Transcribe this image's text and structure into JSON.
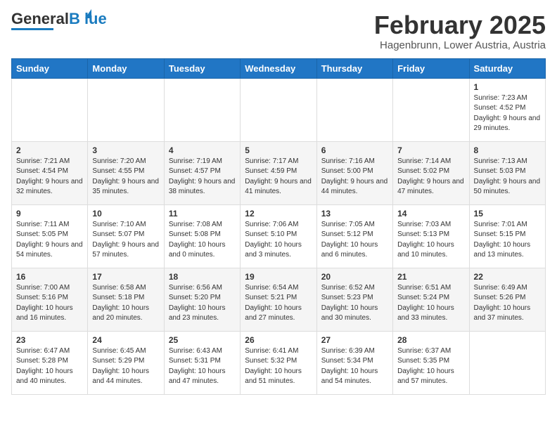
{
  "header": {
    "logo_general": "General",
    "logo_blue": "Blue",
    "month": "February 2025",
    "location": "Hagenbrunn, Lower Austria, Austria"
  },
  "days_of_week": [
    "Sunday",
    "Monday",
    "Tuesday",
    "Wednesday",
    "Thursday",
    "Friday",
    "Saturday"
  ],
  "weeks": [
    [
      {
        "day": "",
        "info": ""
      },
      {
        "day": "",
        "info": ""
      },
      {
        "day": "",
        "info": ""
      },
      {
        "day": "",
        "info": ""
      },
      {
        "day": "",
        "info": ""
      },
      {
        "day": "",
        "info": ""
      },
      {
        "day": "1",
        "info": "Sunrise: 7:23 AM\nSunset: 4:52 PM\nDaylight: 9 hours and 29 minutes."
      }
    ],
    [
      {
        "day": "2",
        "info": "Sunrise: 7:21 AM\nSunset: 4:54 PM\nDaylight: 9 hours and 32 minutes."
      },
      {
        "day": "3",
        "info": "Sunrise: 7:20 AM\nSunset: 4:55 PM\nDaylight: 9 hours and 35 minutes."
      },
      {
        "day": "4",
        "info": "Sunrise: 7:19 AM\nSunset: 4:57 PM\nDaylight: 9 hours and 38 minutes."
      },
      {
        "day": "5",
        "info": "Sunrise: 7:17 AM\nSunset: 4:59 PM\nDaylight: 9 hours and 41 minutes."
      },
      {
        "day": "6",
        "info": "Sunrise: 7:16 AM\nSunset: 5:00 PM\nDaylight: 9 hours and 44 minutes."
      },
      {
        "day": "7",
        "info": "Sunrise: 7:14 AM\nSunset: 5:02 PM\nDaylight: 9 hours and 47 minutes."
      },
      {
        "day": "8",
        "info": "Sunrise: 7:13 AM\nSunset: 5:03 PM\nDaylight: 9 hours and 50 minutes."
      }
    ],
    [
      {
        "day": "9",
        "info": "Sunrise: 7:11 AM\nSunset: 5:05 PM\nDaylight: 9 hours and 54 minutes."
      },
      {
        "day": "10",
        "info": "Sunrise: 7:10 AM\nSunset: 5:07 PM\nDaylight: 9 hours and 57 minutes."
      },
      {
        "day": "11",
        "info": "Sunrise: 7:08 AM\nSunset: 5:08 PM\nDaylight: 10 hours and 0 minutes."
      },
      {
        "day": "12",
        "info": "Sunrise: 7:06 AM\nSunset: 5:10 PM\nDaylight: 10 hours and 3 minutes."
      },
      {
        "day": "13",
        "info": "Sunrise: 7:05 AM\nSunset: 5:12 PM\nDaylight: 10 hours and 6 minutes."
      },
      {
        "day": "14",
        "info": "Sunrise: 7:03 AM\nSunset: 5:13 PM\nDaylight: 10 hours and 10 minutes."
      },
      {
        "day": "15",
        "info": "Sunrise: 7:01 AM\nSunset: 5:15 PM\nDaylight: 10 hours and 13 minutes."
      }
    ],
    [
      {
        "day": "16",
        "info": "Sunrise: 7:00 AM\nSunset: 5:16 PM\nDaylight: 10 hours and 16 minutes."
      },
      {
        "day": "17",
        "info": "Sunrise: 6:58 AM\nSunset: 5:18 PM\nDaylight: 10 hours and 20 minutes."
      },
      {
        "day": "18",
        "info": "Sunrise: 6:56 AM\nSunset: 5:20 PM\nDaylight: 10 hours and 23 minutes."
      },
      {
        "day": "19",
        "info": "Sunrise: 6:54 AM\nSunset: 5:21 PM\nDaylight: 10 hours and 27 minutes."
      },
      {
        "day": "20",
        "info": "Sunrise: 6:52 AM\nSunset: 5:23 PM\nDaylight: 10 hours and 30 minutes."
      },
      {
        "day": "21",
        "info": "Sunrise: 6:51 AM\nSunset: 5:24 PM\nDaylight: 10 hours and 33 minutes."
      },
      {
        "day": "22",
        "info": "Sunrise: 6:49 AM\nSunset: 5:26 PM\nDaylight: 10 hours and 37 minutes."
      }
    ],
    [
      {
        "day": "23",
        "info": "Sunrise: 6:47 AM\nSunset: 5:28 PM\nDaylight: 10 hours and 40 minutes."
      },
      {
        "day": "24",
        "info": "Sunrise: 6:45 AM\nSunset: 5:29 PM\nDaylight: 10 hours and 44 minutes."
      },
      {
        "day": "25",
        "info": "Sunrise: 6:43 AM\nSunset: 5:31 PM\nDaylight: 10 hours and 47 minutes."
      },
      {
        "day": "26",
        "info": "Sunrise: 6:41 AM\nSunset: 5:32 PM\nDaylight: 10 hours and 51 minutes."
      },
      {
        "day": "27",
        "info": "Sunrise: 6:39 AM\nSunset: 5:34 PM\nDaylight: 10 hours and 54 minutes."
      },
      {
        "day": "28",
        "info": "Sunrise: 6:37 AM\nSunset: 5:35 PM\nDaylight: 10 hours and 57 minutes."
      },
      {
        "day": "",
        "info": ""
      }
    ]
  ]
}
